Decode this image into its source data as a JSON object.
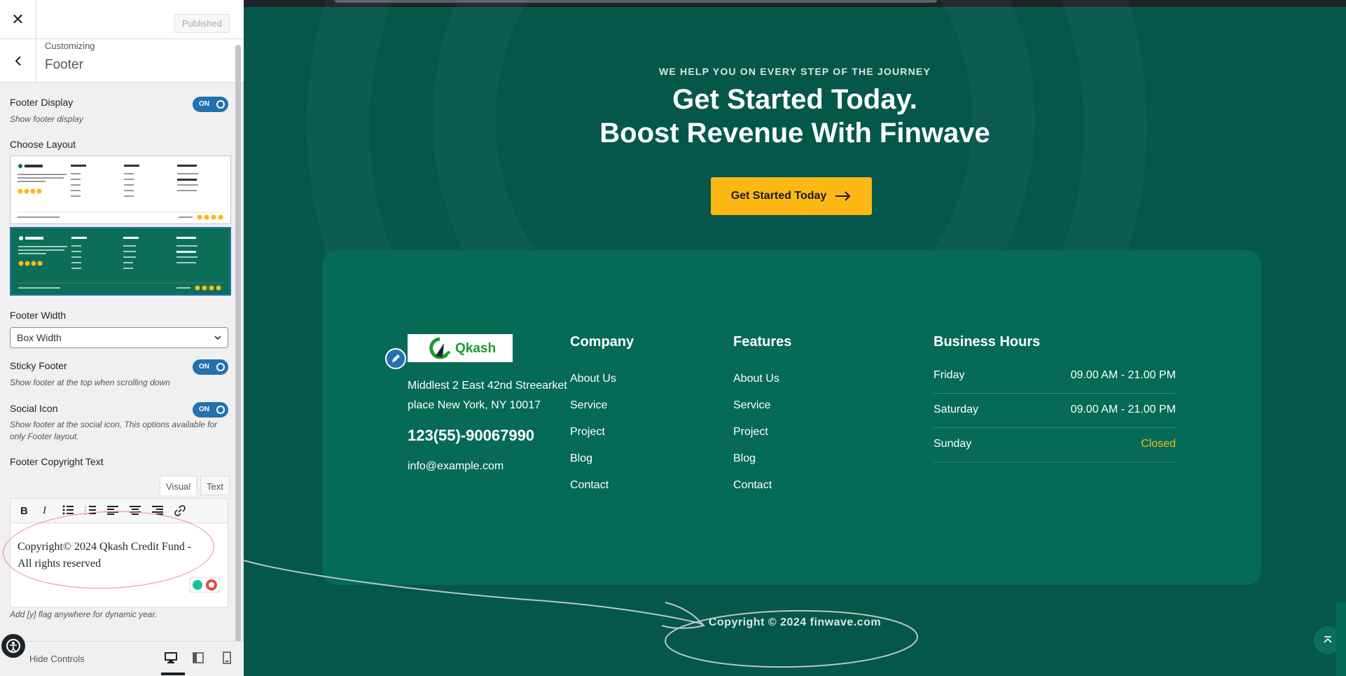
{
  "panel": {
    "close_icon": "close-icon",
    "publish_label": "Published",
    "customizing_label": "Customizing",
    "section_title": "Footer",
    "footer_display": {
      "label": "Footer Display",
      "desc": "Show footer display",
      "state": "ON"
    },
    "choose_layout_label": "Choose Layout",
    "footer_width": {
      "label": "Footer Width",
      "value": "Box Width"
    },
    "sticky_footer": {
      "label": "Sticky Footer",
      "desc": "Show footer at the top when scrolling down",
      "state": "ON"
    },
    "social_icon": {
      "label": "Social Icon",
      "desc": "Show footer at the social icon, This options available for only Footer layout.",
      "state": "ON"
    },
    "copyright_label": "Footer Copyright Text",
    "editor_tabs": [
      "Visual",
      "Text"
    ],
    "editor_content_line1": "Copyright© 2024 Qkash Credit Fund -",
    "editor_content_line2": "All rights reserved",
    "add_flag_note": "Add [y] flag anywhere for dynamic year.",
    "hide_controls_label": "Hide Controls"
  },
  "preview": {
    "eyebrow": "WE HELP YOU ON EVERY STEP OF THE JOURNEY",
    "title_line1": "Get Started Today.",
    "title_line2": "Boost Revenue With Finwave",
    "cta_label": "Get Started Today",
    "logo_text": "Qkash",
    "address": "Middlest 2 East 42nd Streearket place New York, NY 10017",
    "phone": "123(55)-90067990",
    "email": "info@example.com",
    "company": {
      "heading": "Company",
      "links": [
        "About Us",
        "Service",
        "Project",
        "Blog",
        "Contact"
      ]
    },
    "features": {
      "heading": "Features",
      "links": [
        "About Us",
        "Service",
        "Project",
        "Blog",
        "Contact"
      ]
    },
    "hours": {
      "heading": "Business Hours",
      "rows": [
        {
          "day": "Friday",
          "value": "09.00 AM - 21.00 PM"
        },
        {
          "day": "Saturday",
          "value": "09.00 AM - 21.00 PM"
        },
        {
          "day": "Sunday",
          "value": "Closed"
        }
      ]
    },
    "copyright": "Copyright © 2024 finwave.com",
    "colors": {
      "bg": "#05574a",
      "card": "#056a56",
      "accent": "#fdb813"
    }
  }
}
